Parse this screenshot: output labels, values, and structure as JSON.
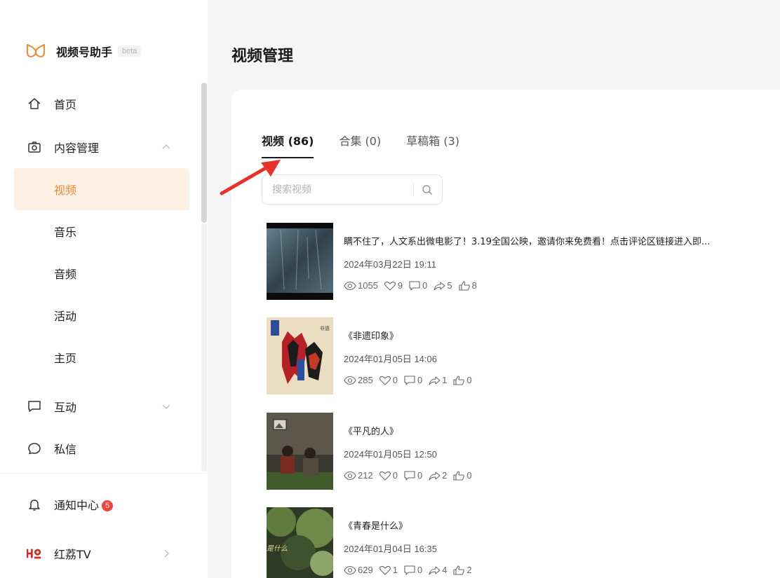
{
  "colors": {
    "accent": "#f08a37",
    "active_bg": "#fdf1e6",
    "badge": "#f2453d",
    "arrow": "#e8322a"
  },
  "brand": {
    "title": "视频号助手",
    "beta": "beta"
  },
  "sidebar": {
    "home": "首页",
    "content": "内容管理",
    "content_sub": [
      "视频",
      "音乐",
      "音频",
      "活动",
      "主页"
    ],
    "interact": "互动",
    "messages": "私信",
    "notify": "通知中心",
    "notify_count": "5",
    "hongtv": "红荔TV"
  },
  "main": {
    "title": "视频管理",
    "tabs": [
      "视频 (86)",
      "合集 (0)",
      "草稿箱 (3)"
    ],
    "search_placeholder": "搜索视频",
    "videos": [
      {
        "title": "瞒不住了，人文系出微电影了！3.19全国公映，邀请你来免费看！点击评论区链接进入即...",
        "date": "2024年03月22日 19:11",
        "views": "1055",
        "likes": "9",
        "comments": "0",
        "shares": "5",
        "thumbs": "8"
      },
      {
        "title": "《非遗印象》",
        "date": "2024年01月05日 14:06",
        "views": "285",
        "likes": "0",
        "comments": "0",
        "shares": "1",
        "thumbs": "0"
      },
      {
        "title": "《平凡的人》",
        "date": "2024年01月05日 12:50",
        "views": "212",
        "likes": "0",
        "comments": "0",
        "shares": "2",
        "thumbs": "0"
      },
      {
        "title": "《青春是什么》",
        "date": "2024年01月04日 16:35",
        "views": "629",
        "likes": "1",
        "comments": "0",
        "shares": "4",
        "thumbs": "2"
      }
    ]
  }
}
